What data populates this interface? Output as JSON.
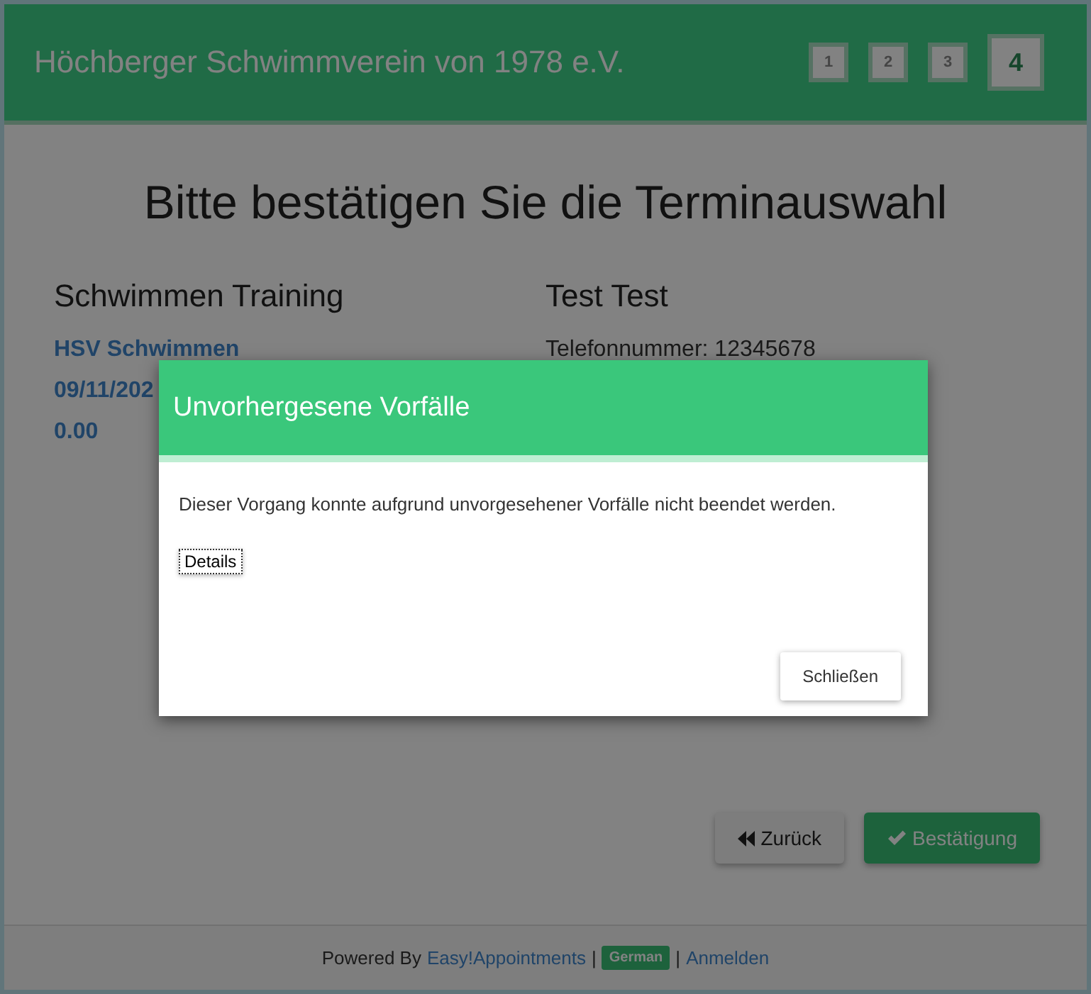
{
  "header": {
    "title": "Höchberger Schwimmverein von 1978 e.V.",
    "steps": [
      {
        "label": "1",
        "selected": false
      },
      {
        "label": "2",
        "selected": false
      },
      {
        "label": "3",
        "selected": false
      },
      {
        "label": "4",
        "selected": true
      }
    ]
  },
  "page": {
    "heading": "Bitte bestätigen Sie die Terminauswahl",
    "service": {
      "title": "Schwimmen Training",
      "lines": [
        "HSV Schwimmen",
        "09/11/202",
        "0.00"
      ]
    },
    "customer": {
      "title": "Test Test",
      "lines": [
        "Telefonnummer: 12345678"
      ]
    },
    "buttons": [
      {
        "label": "Zurück",
        "kind": "back"
      },
      {
        "label": "Bestätigung",
        "kind": "confirm"
      }
    ]
  },
  "footer": {
    "prefix": "Powered By",
    "brand_link": "Easy!Appointments",
    "separator_1": "|",
    "language": "German",
    "separator_2": "|",
    "login_link": "Anmelden"
  },
  "dialog": {
    "title": "Unvorhergesene Vorfälle",
    "message": "Dieser Vorgang konnte aufgrund unvorgesehener Vorfälle nicht beendet werden.",
    "details_button": "Details",
    "close_button": "Schließen"
  }
}
